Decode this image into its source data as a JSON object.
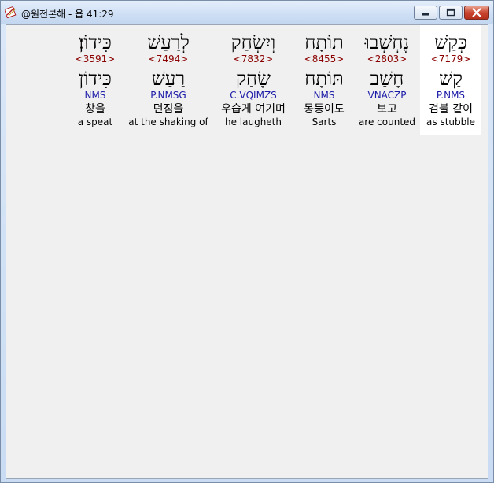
{
  "window": {
    "title": "@원전본해 - 욥 41:29",
    "icon": "bible-book-icon"
  },
  "words": [
    {
      "heb": "כְּקַשׁ",
      "strong": "<7179>",
      "lemma": "קַשׁ",
      "morph": "P.NMS",
      "kor": "검불 같이",
      "eng": "as stubble",
      "selected": true
    },
    {
      "heb": "נֶחְשְׁבוּ",
      "strong": "<2803>",
      "lemma": "חָשַׁב",
      "morph": "VNACZP",
      "kor": "보고",
      "eng": "are counted",
      "selected": false
    },
    {
      "heb": "תוֹתָח",
      "strong": "<8455>",
      "lemma": "תּוֹתָח",
      "morph": "NMS",
      "kor": "몽둥이도",
      "eng": "Sarts",
      "selected": false
    },
    {
      "heb": "וְיִשְׂחַק",
      "strong": "<7832>",
      "lemma": "שָׂחַק",
      "morph": "C.VQIMZS",
      "kor": "우습게 여기며",
      "eng": "he laugheth",
      "selected": false
    },
    {
      "heb": "לְרַעַשׁ",
      "strong": "<7494>",
      "lemma": "רַעַשׁ",
      "morph": "P.NMSG",
      "kor": "던짐을",
      "eng": "at the shaking of",
      "selected": false
    },
    {
      "heb": "כִּידוֹן׃",
      "strong": "<3591>",
      "lemma": "כִּידוֹן",
      "morph": "NMS",
      "kor": "창을",
      "eng": "a speat",
      "selected": false
    }
  ],
  "colors": {
    "strong": "#8b0000",
    "morph": "#1a1aa8",
    "selected_bg": "#ffffff",
    "content_bg": "#f0f0f0"
  }
}
